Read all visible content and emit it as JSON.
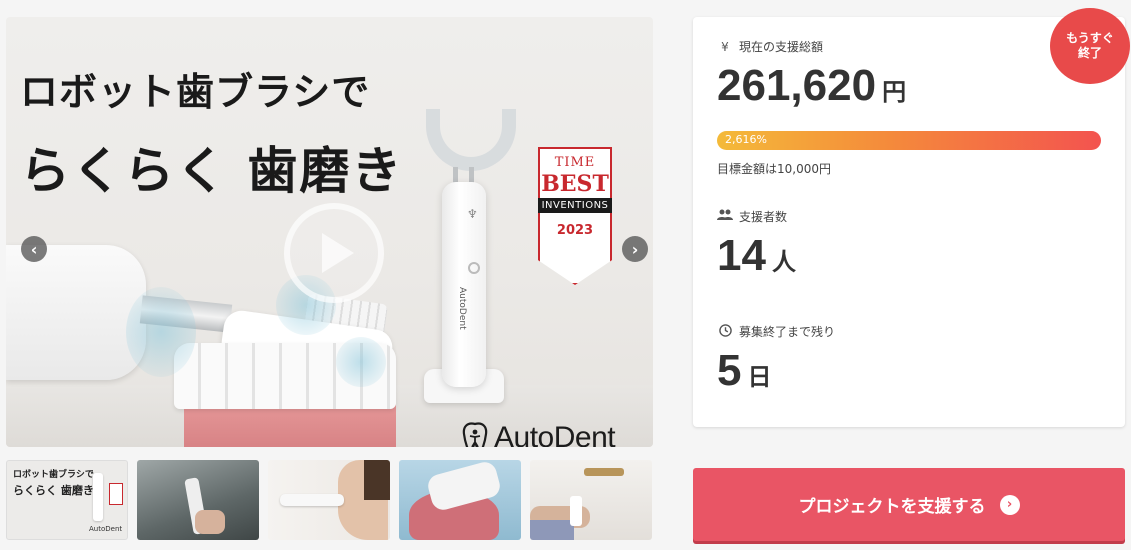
{
  "hero": {
    "headline_line1": "ロボット歯ブラシで",
    "headline_line2": "らくらく 歯磨き",
    "brand_logo": "AutoDent",
    "device_label": "AutoDent",
    "time_badge": {
      "time": "TIME",
      "best": "BEST",
      "inventions": "INVENTIONS",
      "year": "2023"
    },
    "nav": {
      "prev": "‹",
      "next": "›"
    }
  },
  "thumbnails": [
    {
      "line1": "ロボット歯ブラシで",
      "line2": "らくらく 歯磨き",
      "logo": "AutoDent"
    },
    {},
    {},
    {},
    {}
  ],
  "stats": {
    "ending_badge_line1": "もうすぐ",
    "ending_badge_line2": "終了",
    "total_label": "現在の支援総額",
    "total_icon": "yen-icon",
    "total_value": "261,620",
    "total_unit": "円",
    "progress_percent_text": "2,616%",
    "progress_fraction": 1.0,
    "goal_text": "目標金額は10,000円",
    "backers_label": "支援者数",
    "backers_value": "14",
    "backers_unit": "人",
    "remaining_label": "募集終了まで残り",
    "remaining_value": "5",
    "remaining_unit": "日"
  },
  "cta": {
    "label": "プロジェクトを支援する",
    "arrow": "›"
  },
  "colors": {
    "accent": "#e95565",
    "badge": "#e84a4a",
    "progress_start": "#f4ba39",
    "progress_end": "#f3534f",
    "time_red": "#c8282e"
  }
}
